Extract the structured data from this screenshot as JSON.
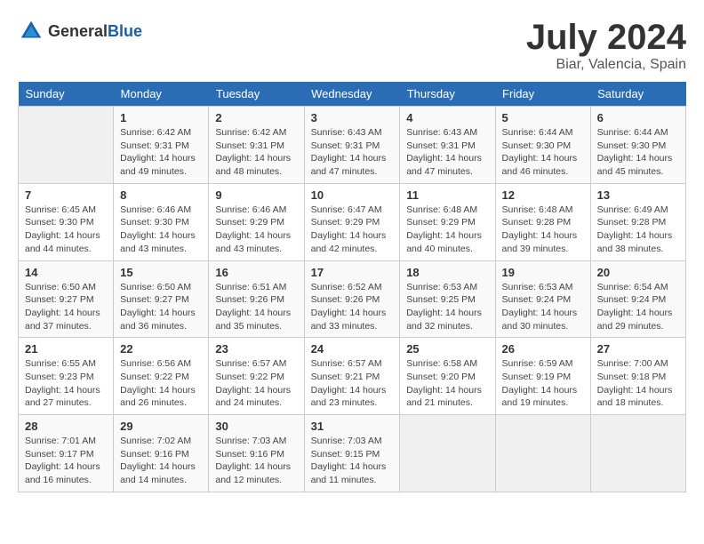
{
  "header": {
    "logo_general": "General",
    "logo_blue": "Blue",
    "month": "July 2024",
    "location": "Biar, Valencia, Spain"
  },
  "weekdays": [
    "Sunday",
    "Monday",
    "Tuesday",
    "Wednesday",
    "Thursday",
    "Friday",
    "Saturday"
  ],
  "weeks": [
    [
      {
        "day": "",
        "sunrise": "",
        "sunset": "",
        "daylight": ""
      },
      {
        "day": "1",
        "sunrise": "Sunrise: 6:42 AM",
        "sunset": "Sunset: 9:31 PM",
        "daylight": "Daylight: 14 hours and 49 minutes."
      },
      {
        "day": "2",
        "sunrise": "Sunrise: 6:42 AM",
        "sunset": "Sunset: 9:31 PM",
        "daylight": "Daylight: 14 hours and 48 minutes."
      },
      {
        "day": "3",
        "sunrise": "Sunrise: 6:43 AM",
        "sunset": "Sunset: 9:31 PM",
        "daylight": "Daylight: 14 hours and 47 minutes."
      },
      {
        "day": "4",
        "sunrise": "Sunrise: 6:43 AM",
        "sunset": "Sunset: 9:31 PM",
        "daylight": "Daylight: 14 hours and 47 minutes."
      },
      {
        "day": "5",
        "sunrise": "Sunrise: 6:44 AM",
        "sunset": "Sunset: 9:30 PM",
        "daylight": "Daylight: 14 hours and 46 minutes."
      },
      {
        "day": "6",
        "sunrise": "Sunrise: 6:44 AM",
        "sunset": "Sunset: 9:30 PM",
        "daylight": "Daylight: 14 hours and 45 minutes."
      }
    ],
    [
      {
        "day": "7",
        "sunrise": "Sunrise: 6:45 AM",
        "sunset": "Sunset: 9:30 PM",
        "daylight": "Daylight: 14 hours and 44 minutes."
      },
      {
        "day": "8",
        "sunrise": "Sunrise: 6:46 AM",
        "sunset": "Sunset: 9:30 PM",
        "daylight": "Daylight: 14 hours and 43 minutes."
      },
      {
        "day": "9",
        "sunrise": "Sunrise: 6:46 AM",
        "sunset": "Sunset: 9:29 PM",
        "daylight": "Daylight: 14 hours and 43 minutes."
      },
      {
        "day": "10",
        "sunrise": "Sunrise: 6:47 AM",
        "sunset": "Sunset: 9:29 PM",
        "daylight": "Daylight: 14 hours and 42 minutes."
      },
      {
        "day": "11",
        "sunrise": "Sunrise: 6:48 AM",
        "sunset": "Sunset: 9:29 PM",
        "daylight": "Daylight: 14 hours and 40 minutes."
      },
      {
        "day": "12",
        "sunrise": "Sunrise: 6:48 AM",
        "sunset": "Sunset: 9:28 PM",
        "daylight": "Daylight: 14 hours and 39 minutes."
      },
      {
        "day": "13",
        "sunrise": "Sunrise: 6:49 AM",
        "sunset": "Sunset: 9:28 PM",
        "daylight": "Daylight: 14 hours and 38 minutes."
      }
    ],
    [
      {
        "day": "14",
        "sunrise": "Sunrise: 6:50 AM",
        "sunset": "Sunset: 9:27 PM",
        "daylight": "Daylight: 14 hours and 37 minutes."
      },
      {
        "day": "15",
        "sunrise": "Sunrise: 6:50 AM",
        "sunset": "Sunset: 9:27 PM",
        "daylight": "Daylight: 14 hours and 36 minutes."
      },
      {
        "day": "16",
        "sunrise": "Sunrise: 6:51 AM",
        "sunset": "Sunset: 9:26 PM",
        "daylight": "Daylight: 14 hours and 35 minutes."
      },
      {
        "day": "17",
        "sunrise": "Sunrise: 6:52 AM",
        "sunset": "Sunset: 9:26 PM",
        "daylight": "Daylight: 14 hours and 33 minutes."
      },
      {
        "day": "18",
        "sunrise": "Sunrise: 6:53 AM",
        "sunset": "Sunset: 9:25 PM",
        "daylight": "Daylight: 14 hours and 32 minutes."
      },
      {
        "day": "19",
        "sunrise": "Sunrise: 6:53 AM",
        "sunset": "Sunset: 9:24 PM",
        "daylight": "Daylight: 14 hours and 30 minutes."
      },
      {
        "day": "20",
        "sunrise": "Sunrise: 6:54 AM",
        "sunset": "Sunset: 9:24 PM",
        "daylight": "Daylight: 14 hours and 29 minutes."
      }
    ],
    [
      {
        "day": "21",
        "sunrise": "Sunrise: 6:55 AM",
        "sunset": "Sunset: 9:23 PM",
        "daylight": "Daylight: 14 hours and 27 minutes."
      },
      {
        "day": "22",
        "sunrise": "Sunrise: 6:56 AM",
        "sunset": "Sunset: 9:22 PM",
        "daylight": "Daylight: 14 hours and 26 minutes."
      },
      {
        "day": "23",
        "sunrise": "Sunrise: 6:57 AM",
        "sunset": "Sunset: 9:22 PM",
        "daylight": "Daylight: 14 hours and 24 minutes."
      },
      {
        "day": "24",
        "sunrise": "Sunrise: 6:57 AM",
        "sunset": "Sunset: 9:21 PM",
        "daylight": "Daylight: 14 hours and 23 minutes."
      },
      {
        "day": "25",
        "sunrise": "Sunrise: 6:58 AM",
        "sunset": "Sunset: 9:20 PM",
        "daylight": "Daylight: 14 hours and 21 minutes."
      },
      {
        "day": "26",
        "sunrise": "Sunrise: 6:59 AM",
        "sunset": "Sunset: 9:19 PM",
        "daylight": "Daylight: 14 hours and 19 minutes."
      },
      {
        "day": "27",
        "sunrise": "Sunrise: 7:00 AM",
        "sunset": "Sunset: 9:18 PM",
        "daylight": "Daylight: 14 hours and 18 minutes."
      }
    ],
    [
      {
        "day": "28",
        "sunrise": "Sunrise: 7:01 AM",
        "sunset": "Sunset: 9:17 PM",
        "daylight": "Daylight: 14 hours and 16 minutes."
      },
      {
        "day": "29",
        "sunrise": "Sunrise: 7:02 AM",
        "sunset": "Sunset: 9:16 PM",
        "daylight": "Daylight: 14 hours and 14 minutes."
      },
      {
        "day": "30",
        "sunrise": "Sunrise: 7:03 AM",
        "sunset": "Sunset: 9:16 PM",
        "daylight": "Daylight: 14 hours and 12 minutes."
      },
      {
        "day": "31",
        "sunrise": "Sunrise: 7:03 AM",
        "sunset": "Sunset: 9:15 PM",
        "daylight": "Daylight: 14 hours and 11 minutes."
      },
      {
        "day": "",
        "sunrise": "",
        "sunset": "",
        "daylight": ""
      },
      {
        "day": "",
        "sunrise": "",
        "sunset": "",
        "daylight": ""
      },
      {
        "day": "",
        "sunrise": "",
        "sunset": "",
        "daylight": ""
      }
    ]
  ]
}
